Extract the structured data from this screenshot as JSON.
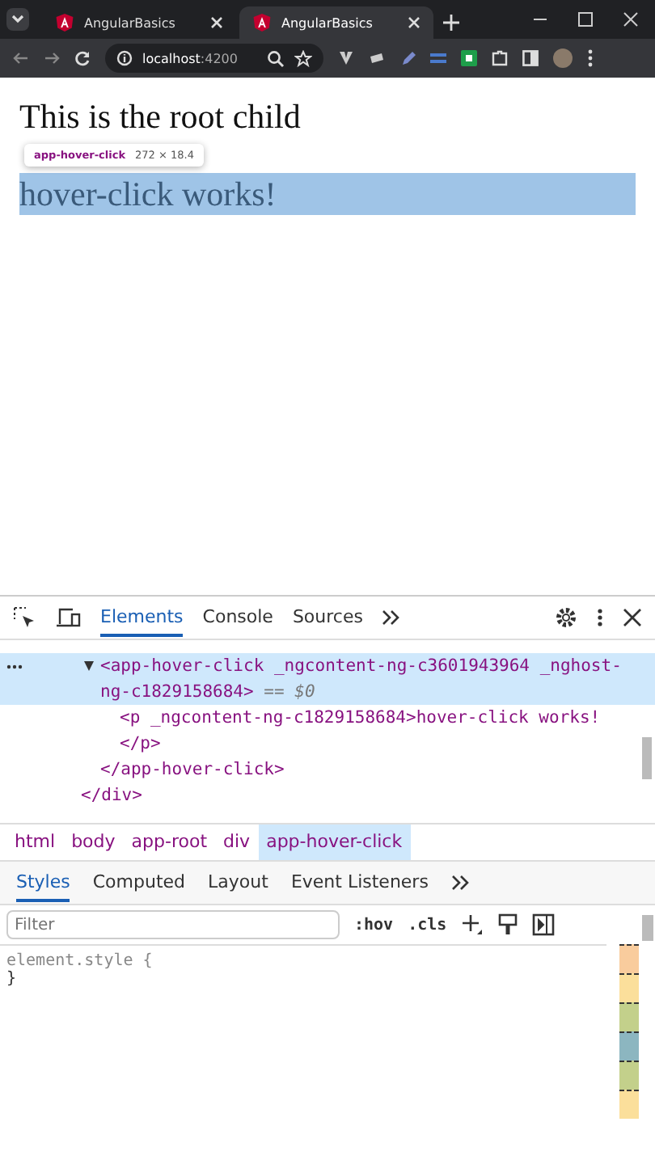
{
  "browser": {
    "tabs": [
      {
        "title": "AngularBasics",
        "selected": false
      },
      {
        "title": "AngularBasics",
        "selected": true
      }
    ],
    "address": "**localhost**:4200"
  },
  "page": {
    "heading": "This is the root child",
    "tooltip": {
      "tag": "app-hover-click",
      "size": "272 × 18.4"
    },
    "highlighted_text": "hover-click works!"
  },
  "devtools": {
    "panel_tabs": [
      {
        "label": "Elements",
        "selected": true
      },
      {
        "label": "Console",
        "selected": false
      },
      {
        "label": "Sources",
        "selected": false
      }
    ],
    "dom": [
      {
        "close": "</div>",
        "children": [
          {
            "open": "<app-hover-click _ngcontent-ng-c3601943964 _nghost-ng-c1829158684>",
            "note": "== $0",
            "selected": true,
            "expanded": true,
            "close": "</app-hover-click>",
            "children": [
              {
                "open": "<p _ngcontent-ng-c1829158684>hover-click works!",
                "close": "</p>",
                "selected": false
              }
            ]
          }
        ]
      }
    ],
    "breadcrumbs": [
      {
        "label": "html",
        "selected": false
      },
      {
        "label": "body",
        "selected": false
      },
      {
        "label": "app-root",
        "selected": false
      },
      {
        "label": "div",
        "selected": false
      },
      {
        "label": "app-hover-click",
        "selected": true
      }
    ],
    "style_tabs": [
      {
        "label": "Styles",
        "selected": true
      },
      {
        "label": "Computed",
        "selected": false
      },
      {
        "label": "Layout",
        "selected": false
      },
      {
        "label": "Event Listeners",
        "selected": false
      }
    ],
    "filter": {
      "placeholder": "Filter"
    },
    "filter_buttons": [
      ":hov",
      ".cls"
    ],
    "rule": {
      "selector": "element.style {",
      "end": "}"
    }
  }
}
